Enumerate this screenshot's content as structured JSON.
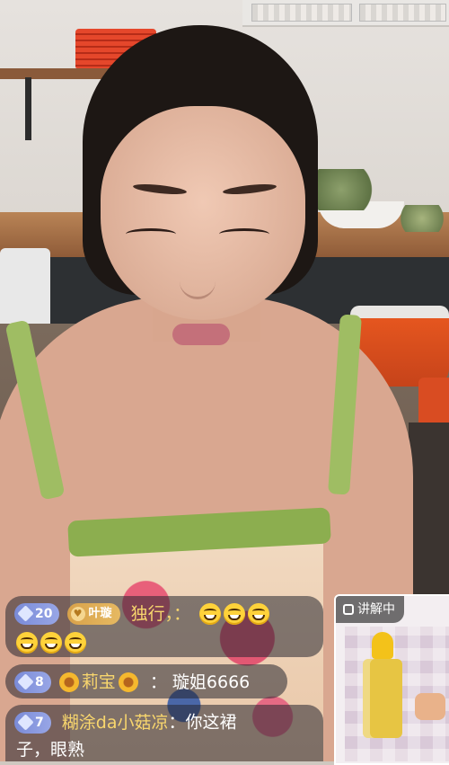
{
  "live_comments": [
    {
      "level": "20",
      "fan_badge": "叶璇",
      "username": "独行，：",
      "message": "",
      "emoji_line1_count": 3,
      "emoji_line2_count": 3,
      "emoji_name": "grinning-face"
    },
    {
      "level": "8",
      "username": "莉宝",
      "message": "：  璇姐6666"
    },
    {
      "level": "7",
      "username": "糊涂da小菇凉",
      "message_line1": "：你这裙",
      "message_line2": "子，眼熟"
    }
  ],
  "explain_card": {
    "tag": "讲解中"
  }
}
